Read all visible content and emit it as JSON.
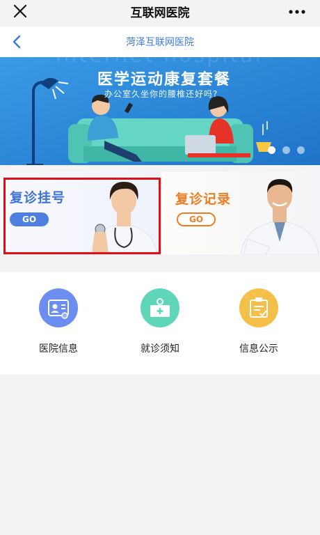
{
  "wechat_bar": {
    "title": "互联网医院",
    "close_icon": "close-icon",
    "more_icon": "more-icon"
  },
  "header": {
    "title": "菏泽互联网医院",
    "back_icon": "chevron-left-icon",
    "accent": "#3d7be0"
  },
  "banner": {
    "watermark": "internet hospital",
    "title": "医学运动康复套餐",
    "subtitle": "办公室久坐你的腰椎还好吗?",
    "background": "#2f8bd9",
    "slides": 3,
    "active_slide": 1
  },
  "cards": [
    {
      "label": "复诊挂号",
      "button": "GO",
      "color": "#3f73d6",
      "image": "female-doctor-with-stethoscope"
    },
    {
      "label": "复诊记录",
      "button": "GO",
      "color": "#ee7d22",
      "image": "male-doctor"
    }
  ],
  "menu": [
    {
      "label": "医院信息",
      "icon": "hospital-info-icon",
      "color": "#6c8ef0"
    },
    {
      "label": "就诊须知",
      "icon": "medical-notice-icon",
      "color": "#5fd6b8"
    },
    {
      "label": "信息公示",
      "icon": "info-publish-icon",
      "color": "#f5c04a"
    }
  ]
}
